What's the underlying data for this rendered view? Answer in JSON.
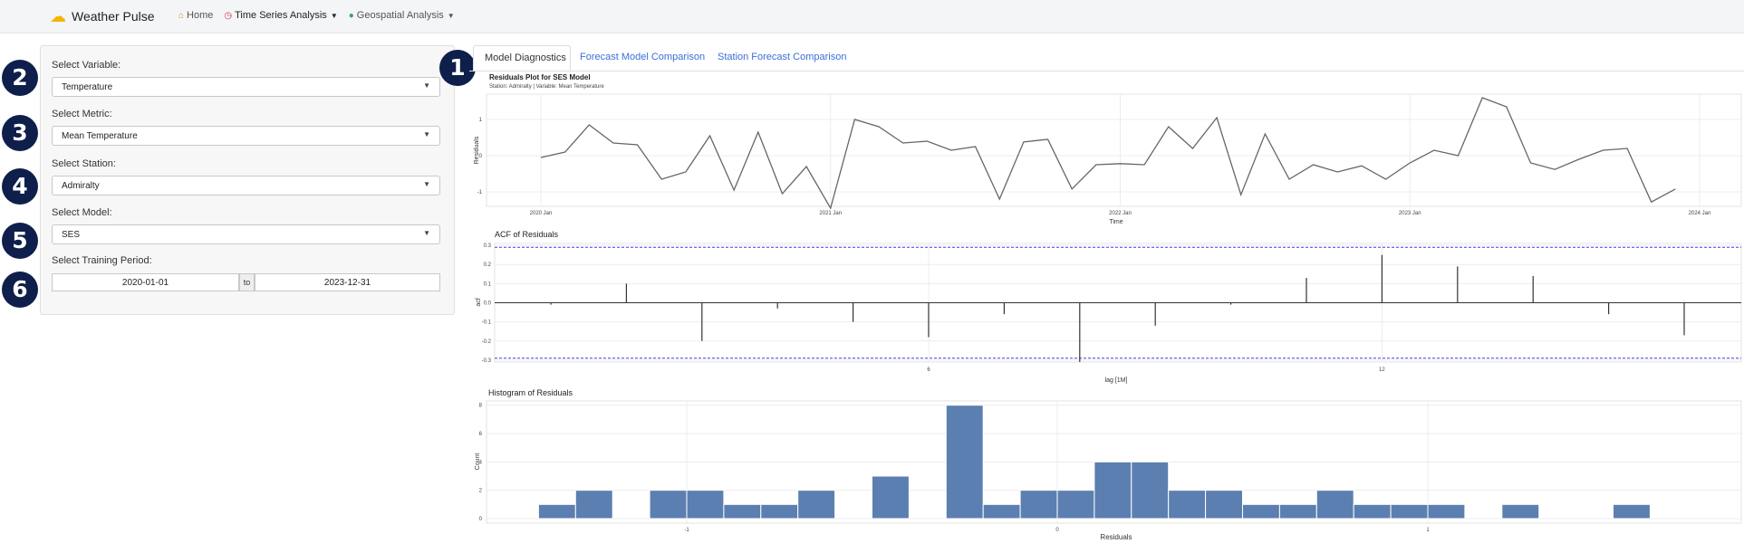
{
  "app": {
    "title": "Weather Pulse"
  },
  "nav": [
    {
      "label": "Home",
      "icon": "home-icon"
    },
    {
      "label": "Time Series Analysis",
      "icon": "clock-icon"
    },
    {
      "label": "Geospatial Analysis",
      "icon": "map-pin-icon"
    }
  ],
  "sidebar": {
    "variable": {
      "label": "Select Variable:",
      "value": "Temperature"
    },
    "metric": {
      "label": "Select Metric:",
      "value": "Mean Temperature"
    },
    "station": {
      "label": "Select Station:",
      "value": "Admiralty"
    },
    "model": {
      "label": "Select Model:",
      "value": "SES"
    },
    "training": {
      "label": "Select Training Period:",
      "start": "2020-01-01",
      "to": "to",
      "end": "2023-12-31"
    }
  },
  "badges": [
    "1",
    "2",
    "3",
    "4",
    "5",
    "6"
  ],
  "tabs": [
    {
      "label": "Model Diagnostics",
      "active": true
    },
    {
      "label": "Forecast Model Comparison",
      "active": false
    },
    {
      "label": "Station Forecast Comparison",
      "active": false
    }
  ],
  "colors": {
    "accent": "#3a6fd8",
    "badge": "#0f1f4b",
    "bar": "#5b7fb0",
    "line": "#555555",
    "ci": "#3a3ff0"
  },
  "chart_data": [
    {
      "type": "line",
      "title": "Residuals Plot for SES Model",
      "subtitle": "Station: Admiralty | Variable: Mean Temperature",
      "xlabel": "Time",
      "ylabel": "Residuals",
      "x_ticks": [
        "2020 Jan",
        "2021 Jan",
        "2022 Jan",
        "2023 Jan",
        "2024 Jan"
      ],
      "y_ticks": [
        -1,
        0,
        1
      ],
      "ylim": [
        -1.4,
        1.7
      ],
      "x_start": "2020 Jan",
      "values": [
        -0.05,
        0.1,
        0.85,
        0.35,
        0.3,
        -0.65,
        -0.45,
        0.55,
        -0.95,
        0.65,
        -1.05,
        -0.3,
        -1.45,
        1.0,
        0.8,
        0.35,
        0.4,
        0.15,
        0.25,
        -1.2,
        0.38,
        0.45,
        -0.92,
        -0.25,
        -0.22,
        -0.25,
        0.8,
        0.2,
        1.05,
        -1.08,
        0.6,
        -0.65,
        -0.25,
        -0.45,
        -0.28,
        -0.65,
        -0.2,
        0.15,
        0.0,
        1.6,
        1.35,
        -0.2,
        -0.38,
        -0.1,
        0.15,
        0.2,
        -1.28,
        -0.92
      ],
      "grid": true
    },
    {
      "type": "bar",
      "title": "ACF of Residuals",
      "xlabel": "lag [1M]",
      "ylabel": "acf",
      "x_ticks": [
        6,
        12
      ],
      "y_ticks": [
        -0.3,
        -0.2,
        -0.1,
        0.0,
        0.1,
        0.2,
        0.3
      ],
      "ylim": [
        -0.31,
        0.31
      ],
      "lags": [
        1,
        2,
        3,
        4,
        5,
        6,
        7,
        8,
        9,
        10,
        11,
        12,
        13,
        14,
        15,
        16
      ],
      "values": [
        -0.01,
        0.1,
        -0.2,
        -0.03,
        -0.1,
        -0.18,
        -0.06,
        -0.31,
        -0.12,
        -0.01,
        0.13,
        0.25,
        0.19,
        0.14,
        -0.06,
        -0.17
      ],
      "ci": 0.29
    },
    {
      "type": "bar",
      "title": "Histogram of Residuals",
      "xlabel": "Residuals",
      "ylabel": "Count",
      "x_ticks": [
        -1,
        0,
        1
      ],
      "y_ticks": [
        0,
        2,
        4,
        6,
        8
      ],
      "ylim": [
        0,
        8.3
      ],
      "bins": [
        1,
        2,
        0,
        2,
        2,
        1,
        1,
        2,
        0,
        3,
        0,
        8,
        1,
        2,
        2,
        4,
        4,
        2,
        2,
        1,
        1,
        2,
        1,
        1,
        1,
        0,
        1,
        0,
        0,
        1
      ],
      "bin_start": -1.4,
      "bin_width": 0.1
    }
  ]
}
